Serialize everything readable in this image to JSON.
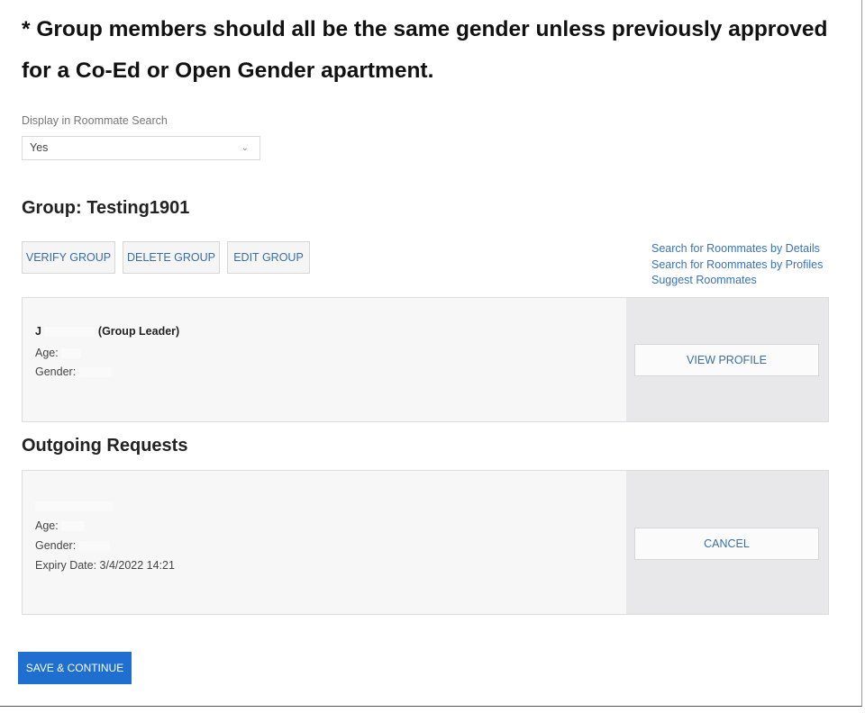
{
  "notice": "* Group members should all be the same gender unless previously approved for a Co-Ed or Open Gender apartment.",
  "display_search": {
    "label": "Display in Roommate Search",
    "value": "Yes"
  },
  "group": {
    "title": "Group: Testing1901",
    "buttons": {
      "verify": "VERIFY GROUP",
      "delete": "DELETE GROUP",
      "edit": "EDIT GROUP"
    },
    "links": [
      "Search for Roommates by Details",
      "Search for Roommates by Profiles",
      "Suggest Roommates"
    ],
    "member": {
      "name_prefix": "J",
      "role": "(Group Leader)",
      "age_label": "Age:",
      "gender_label": "Gender:",
      "action": "VIEW PROFILE"
    }
  },
  "outgoing": {
    "title": "Outgoing Requests",
    "request": {
      "age_label": "Age:",
      "gender_label": "Gender:",
      "expiry": "Expiry Date: 3/4/2022 14:21",
      "action": "CANCEL"
    }
  },
  "save_label": "SAVE & CONTINUE"
}
